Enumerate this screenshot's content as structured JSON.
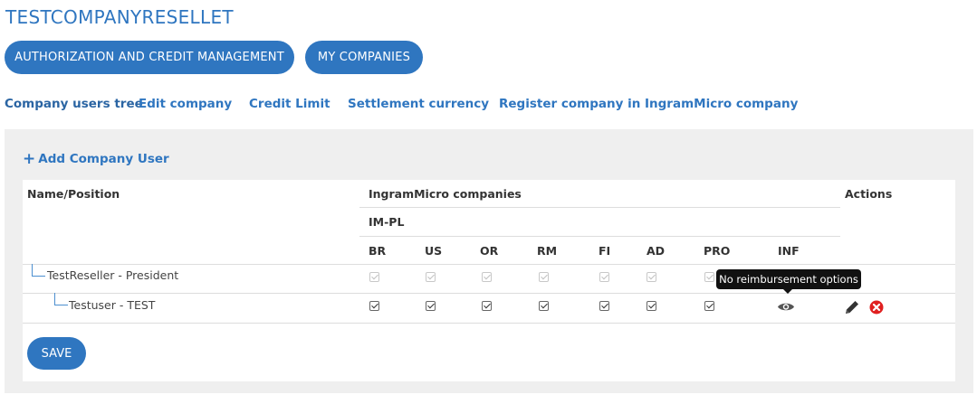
{
  "company": {
    "name": "TESTCOMPANYRESELLET"
  },
  "top_buttons": {
    "auth": "AUTHORIZATION AND CREDIT MANAGEMENT",
    "my_companies": "MY COMPANIES"
  },
  "sub_nav": [
    "Company users tree",
    "Edit company",
    "Credit Limit",
    "Settlement currency",
    "Register company in IngramMicro company"
  ],
  "panel": {
    "add_user_label": "Add Company User",
    "add_user_icon": "plus-icon",
    "save_label": "SAVE"
  },
  "table": {
    "header_name": "Name/Position",
    "header_group": "IngramMicro companies",
    "header_sub_group": "IM-PL",
    "header_actions": "Actions",
    "columns": [
      "BR",
      "US",
      "OR",
      "RM",
      "FI",
      "AD",
      "PRO",
      "INF"
    ],
    "rows": [
      {
        "name": "TestReseller - President",
        "checks": [
          true,
          true,
          true,
          true,
          true,
          true,
          true
        ],
        "enabled": false
      },
      {
        "name": "Testuser - TEST",
        "checks": [
          true,
          true,
          true,
          true,
          true,
          true,
          true
        ],
        "enabled": true
      }
    ],
    "tooltip": "No reimbursement options",
    "icons": {
      "view": "eye-icon",
      "edit": "pencil-icon",
      "delete": "delete-circle-icon"
    }
  },
  "colors": {
    "accent": "#2f76c0",
    "danger": "#e02020",
    "panel": "#efefef"
  }
}
